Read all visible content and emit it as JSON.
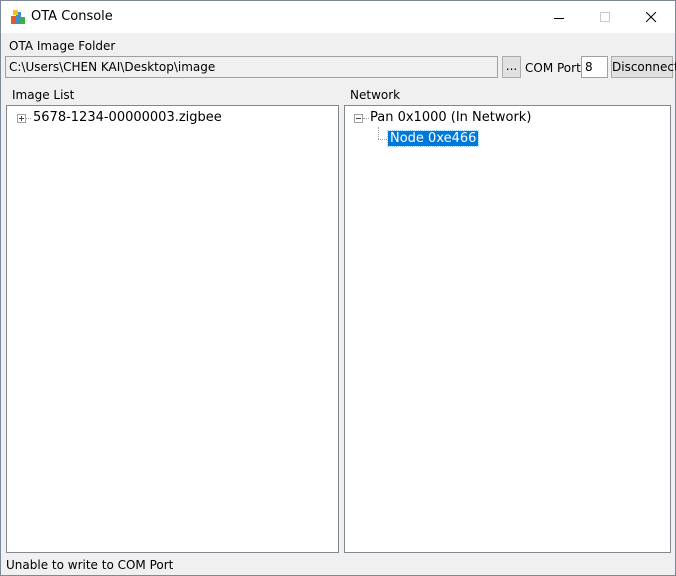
{
  "window": {
    "title": "OTA Console",
    "icon": "ota-app-icon",
    "controls": [
      "minimize-icon",
      "maximize-icon",
      "close-icon"
    ]
  },
  "folder": {
    "label": "OTA Image Folder",
    "path": "C:\\Users\\CHEN KAI\\Desktop\\image",
    "browse_label": "..."
  },
  "com": {
    "label": "COM Port:",
    "value": "8",
    "disconnect_label": "Disconnect"
  },
  "image_list": {
    "label": "Image List",
    "items": [
      {
        "name": "5678-1234-00000003.zigbee",
        "expanded": false
      }
    ]
  },
  "network": {
    "label": "Network",
    "pan": {
      "name": "Pan 0x1000 (In Network)",
      "expanded": true
    },
    "nodes": [
      {
        "name": "Node 0xe466",
        "selected": true
      }
    ]
  },
  "status": {
    "text": "Unable to write to COM Port"
  },
  "colors": {
    "selection": "#0078d7",
    "window_bg": "#f0f0f0"
  }
}
